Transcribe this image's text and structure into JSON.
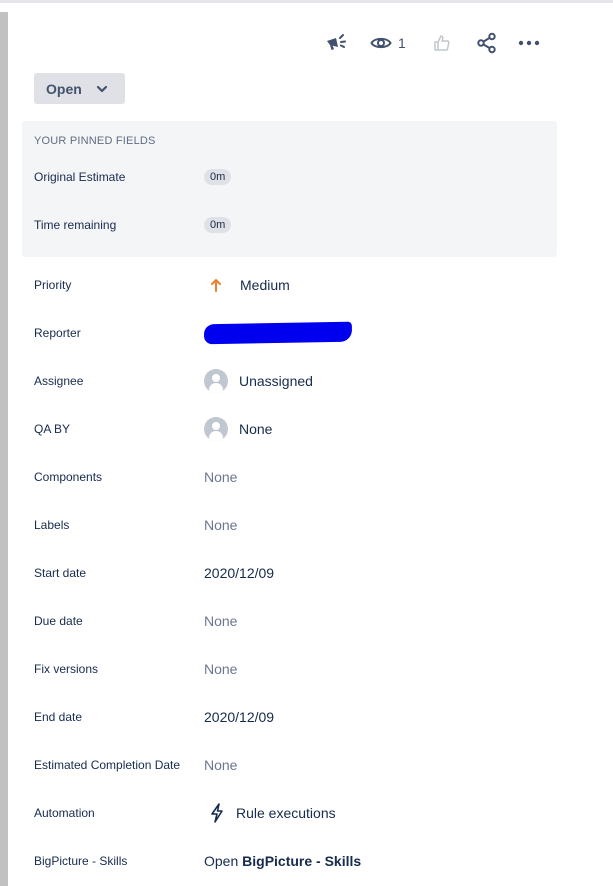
{
  "toolbar": {
    "watch_count": "1"
  },
  "status": {
    "label": "Open"
  },
  "pinned": {
    "title": "YOUR PINNED FIELDS",
    "fields": [
      {
        "label": "Original Estimate",
        "value": "0m"
      },
      {
        "label": "Time remaining",
        "value": "0m"
      }
    ]
  },
  "fields": {
    "priority": {
      "label": "Priority",
      "value": "Medium"
    },
    "reporter": {
      "label": "Reporter"
    },
    "assignee": {
      "label": "Assignee",
      "value": "Unassigned"
    },
    "qa_by": {
      "label": "QA BY",
      "value": "None"
    },
    "components": {
      "label": "Components",
      "value": "None"
    },
    "labels": {
      "label": "Labels",
      "value": "None"
    },
    "start_date": {
      "label": "Start date",
      "value": "2020/12/09"
    },
    "due_date": {
      "label": "Due date",
      "value": "None"
    },
    "fix_versions": {
      "label": "Fix versions",
      "value": "None"
    },
    "end_date": {
      "label": "End date",
      "value": "2020/12/09"
    },
    "estimated_completion": {
      "label": "Estimated Completion Date",
      "value": "None"
    },
    "automation": {
      "label": "Automation",
      "value": "Rule executions"
    },
    "bigpicture": {
      "label": "BigPicture - Skills",
      "value_prefix": "Open",
      "value_strong": "BigPicture - Skills"
    }
  },
  "colors": {
    "priority_medium": "#e97f33",
    "redaction": "#0000ee"
  }
}
